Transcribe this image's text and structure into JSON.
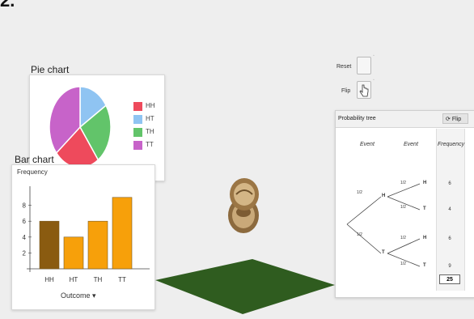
{
  "corner_label": "2.",
  "colors": {
    "ground": "#2f5c1f",
    "pie_hh": "#ee4a5c",
    "pie_ht": "#8fc4f2",
    "pie_th": "#62c46a",
    "pie_tt": "#c763c9",
    "bar_hh": "#8a5b10",
    "bar_other": "#f7a00a"
  },
  "icons": {
    "coin": "coin-icon",
    "hand": "hand-cursor-icon",
    "flip": "flip-icon"
  },
  "controls": {
    "reset_label": "Reset",
    "flip_label": "Flip"
  },
  "pie": {
    "title": "Pie chart",
    "legend": [
      "HH",
      "HT",
      "TH",
      "TT"
    ]
  },
  "bar": {
    "title": "Bar chart",
    "ylabel": "Frequency",
    "outcome_label": "Outcome ▾"
  },
  "tree": {
    "title": "Probability tree",
    "flip_tab": "Flip",
    "col_event1": "Event",
    "col_event2": "Event",
    "col_frequency": "Frequency",
    "first_nodes": [
      "H",
      "T"
    ],
    "second_nodes": [
      "H",
      "T",
      "H",
      "T"
    ],
    "frequencies": [
      "6",
      "4",
      "6",
      "9"
    ],
    "total": "25",
    "prob": "1/2"
  },
  "chart_data": [
    {
      "type": "pie",
      "title": "Pie chart",
      "categories": [
        "HH",
        "HT",
        "TH",
        "TT"
      ],
      "values": [
        6,
        4,
        6,
        9
      ]
    },
    {
      "type": "bar",
      "title": "Bar chart",
      "categories": [
        "HH",
        "HT",
        "TH",
        "TT"
      ],
      "values": [
        6,
        4,
        6,
        9
      ],
      "xlabel": "Outcome",
      "ylabel": "Frequency",
      "ylim": [
        0,
        10
      ],
      "yticks": [
        2,
        4,
        6,
        8
      ]
    }
  ]
}
